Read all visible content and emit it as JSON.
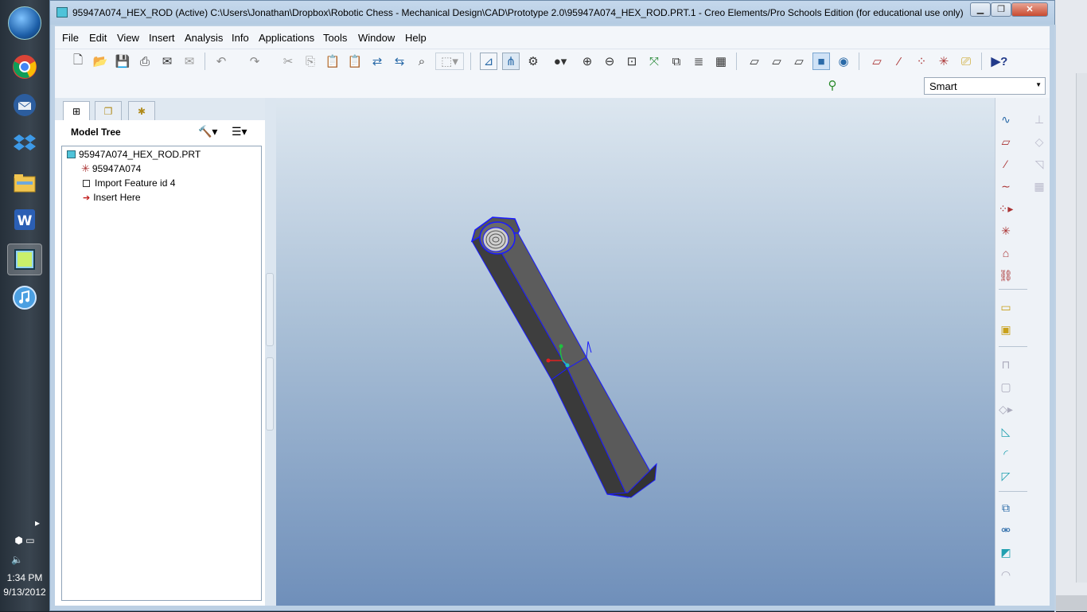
{
  "window": {
    "title": "95947A074_HEX_ROD (Active) C:\\Users\\Jonathan\\Dropbox\\Robotic Chess - Mechanical Design\\CAD\\Prototype 2.0\\95947A074_HEX_ROD.PRT.1 - Creo Elements/Pro Schools Edition (for educational use only)",
    "controls": [
      "minimize",
      "maximize",
      "close"
    ]
  },
  "menubar": [
    "File",
    "Edit",
    "View",
    "Insert",
    "Analysis",
    "Info",
    "Applications",
    "Tools",
    "Window",
    "Help"
  ],
  "toolbar": {
    "icons": [
      "new-icon",
      "open-icon",
      "save-icon",
      "print-icon",
      "send-icon",
      "email-icon",
      "undo-icon",
      "redo-icon",
      "cut-icon",
      "copy-icon",
      "paste-icon",
      "paste-special-icon",
      "regenerate-icon",
      "regen-manager-icon",
      "find-icon",
      "select-box-icon",
      "orient-icon",
      "datum-icon",
      "spin-center-icon",
      "shading-icon",
      "zoom-in-icon",
      "zoom-out-icon",
      "refit-icon",
      "reorient-icon",
      "saved-views-icon",
      "layers-icon",
      "view-manager-icon",
      "wireframe-icon",
      "hidden-line-icon",
      "no-hidden-icon",
      "shaded-icon",
      "enhanced-realism-icon",
      "datum-planes-icon",
      "datum-axes-icon",
      "datum-points-icon",
      "csys-icon",
      "annotations-icon",
      "context-help-icon"
    ]
  },
  "filter": {
    "selected": "Smart"
  },
  "navigator": {
    "tabs": [
      "model-tree-tab",
      "folder-browser-tab",
      "favorites-tab"
    ],
    "title": "Model Tree",
    "tree": [
      {
        "label": "95947A074_HEX_ROD.PRT",
        "icon": "part-icon",
        "indent": 0
      },
      {
        "label": "95947A074",
        "icon": "csys-icon",
        "indent": 1
      },
      {
        "label": "Import Feature id 4",
        "icon": "import-feature-icon",
        "indent": 1
      },
      {
        "label": "Insert Here",
        "icon": "insert-arrow-icon",
        "indent": 1
      }
    ]
  },
  "taskbar": {
    "apps": [
      "chrome-icon",
      "thunderbird-icon",
      "dropbox-icon",
      "explorer-icon",
      "word-icon",
      "creo-icon",
      "itunes-icon"
    ],
    "time": "1:34 PM",
    "date": "9/13/2012"
  },
  "colors": {
    "accent": "#1d5fa8",
    "model_edge": "#1a1aff",
    "model_face": "#5a5a5a"
  }
}
